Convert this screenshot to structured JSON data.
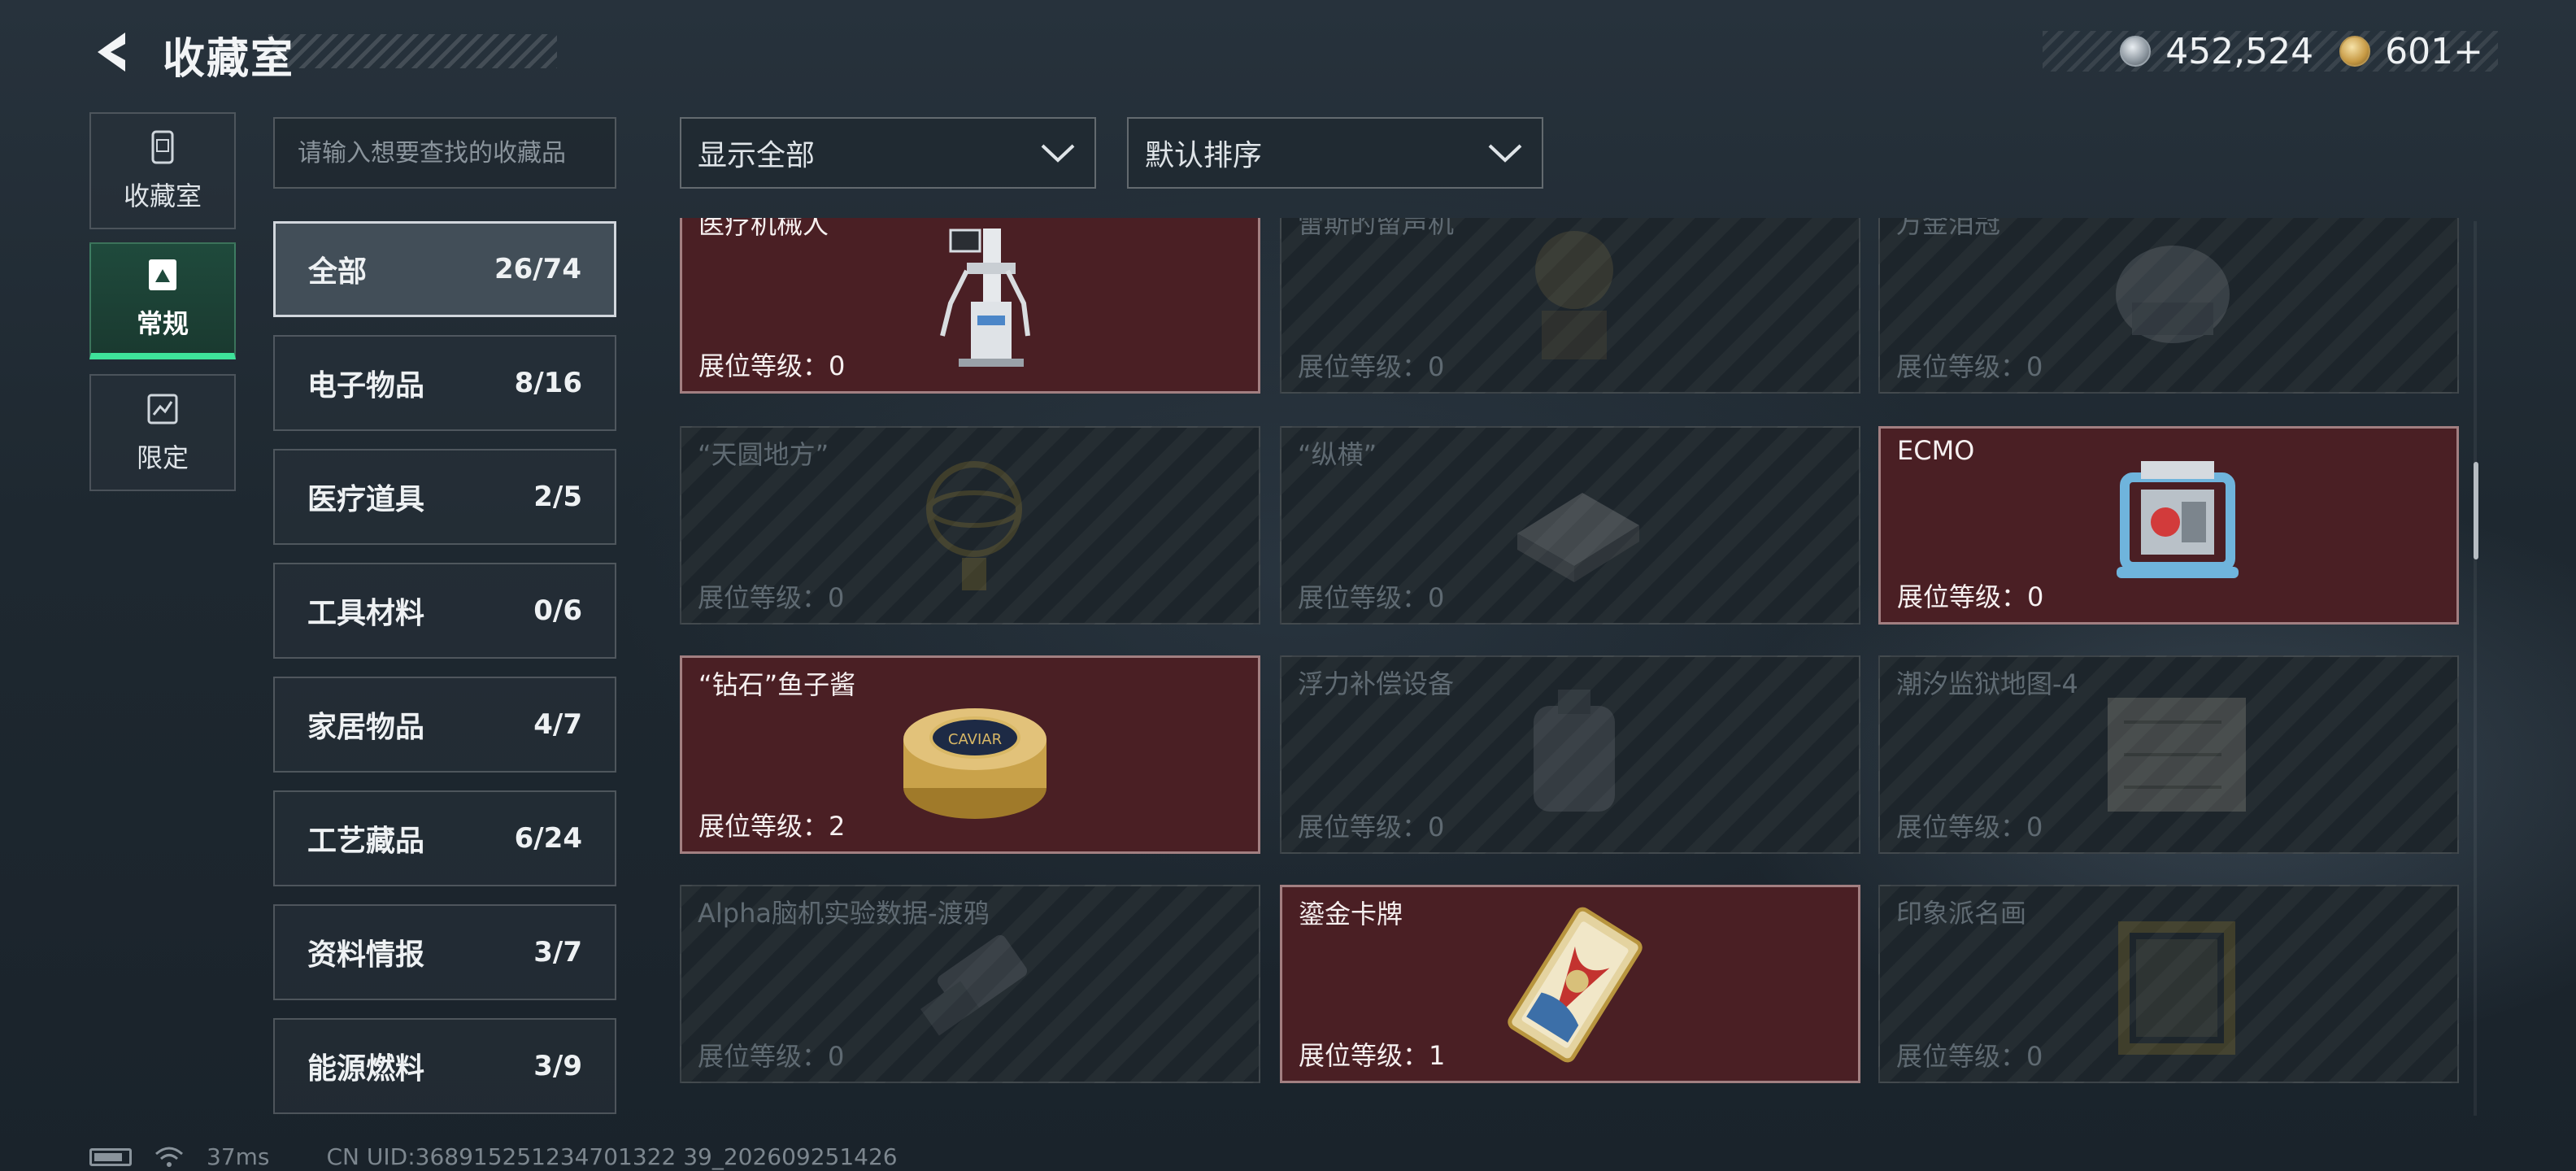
{
  "header": {
    "title": "收藏室",
    "currency": [
      {
        "icon": "silver-coin-icon",
        "value": "452,524"
      },
      {
        "icon": "gold-coin-icon",
        "value": "601+"
      }
    ]
  },
  "modes": [
    {
      "label": "收藏室",
      "icon": "collection-room-icon",
      "active": false
    },
    {
      "label": "常规",
      "icon": "regular-icon",
      "active": true
    },
    {
      "label": "限定",
      "icon": "limited-icon",
      "active": false
    }
  ],
  "search": {
    "placeholder": "请输入想要查找的收藏品"
  },
  "categories": [
    {
      "name": "全部",
      "count": "26/74",
      "active": true
    },
    {
      "name": "电子物品",
      "count": "8/16"
    },
    {
      "name": "医疗道具",
      "count": "2/5"
    },
    {
      "name": "工具材料",
      "count": "0/6"
    },
    {
      "name": "家居物品",
      "count": "4/7"
    },
    {
      "name": "工艺藏品",
      "count": "6/24"
    },
    {
      "name": "资料情报",
      "count": "3/7"
    },
    {
      "name": "能源燃料",
      "count": "3/9"
    }
  ],
  "filters": {
    "show": "显示全部",
    "sort": "默认排序"
  },
  "items": [
    {
      "name": "医疗机械人",
      "level": "展位等级：0",
      "owned": true,
      "icon": "medical-robot-icon"
    },
    {
      "name": "雷斯的留声机",
      "level": "展位等级：0",
      "owned": false,
      "icon": "gramophone-icon"
    },
    {
      "name": "万金泪冠",
      "level": "展位等级：0",
      "owned": false,
      "icon": "crown-icon"
    },
    {
      "name": "“天圆地方”",
      "level": "展位等级：0",
      "owned": false,
      "icon": "armillary-icon"
    },
    {
      "name": "“纵横”",
      "level": "展位等级：0",
      "owned": false,
      "icon": "chessboard-icon"
    },
    {
      "name": "ECMO",
      "level": "展位等级：0",
      "owned": true,
      "icon": "ecmo-machine-icon"
    },
    {
      "name": "“钻石”鱼子酱",
      "level": "展位等级：2",
      "owned": true,
      "icon": "caviar-tin-icon",
      "badge": "CAVIAR"
    },
    {
      "name": "浮力补偿设备",
      "level": "展位等级：0",
      "owned": false,
      "icon": "buoyancy-device-icon"
    },
    {
      "name": "潮汐监狱地图-4",
      "level": "展位等级：0",
      "owned": false,
      "icon": "map-icon"
    },
    {
      "name": "Alpha脑机实验数据-渡鸦",
      "level": "展位等级：0",
      "owned": false,
      "icon": "data-drive-icon"
    },
    {
      "name": "鎏金卡牌",
      "level": "展位等级：1",
      "owned": true,
      "icon": "gilded-card-icon"
    },
    {
      "name": "印象派名画",
      "level": "展位等级：0",
      "owned": false,
      "icon": "painting-icon"
    }
  ],
  "status": {
    "ping": "37ms",
    "uid": "CN UID:368915251234701322 39_202609251426"
  },
  "colors": {
    "owned_card": "#4a1f24",
    "active_tab": "#3ee39a"
  }
}
